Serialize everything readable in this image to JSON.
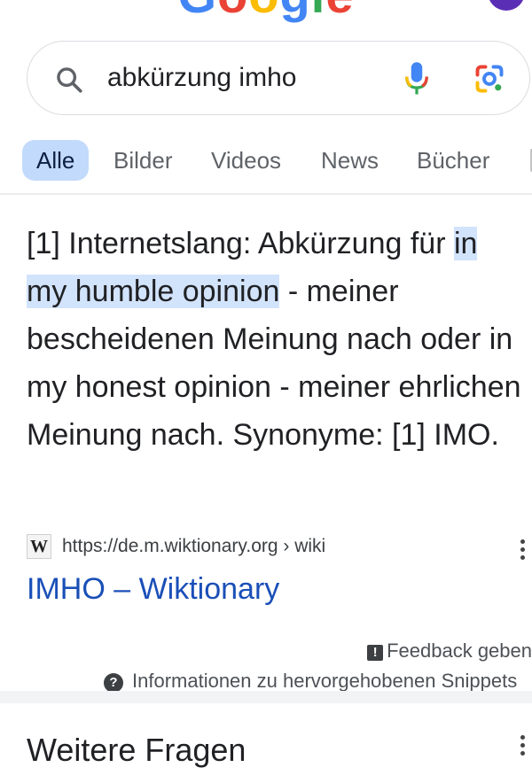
{
  "brand": {
    "logo_text": "Google",
    "colors": [
      "#4285F4",
      "#EA4335",
      "#FBBC05",
      "#4285F4",
      "#34A853",
      "#EA4335"
    ]
  },
  "search": {
    "query": "abkürzung imho"
  },
  "tabs": [
    {
      "label": "Alle",
      "active": true
    },
    {
      "label": "Bilder",
      "active": false
    },
    {
      "label": "Videos",
      "active": false
    },
    {
      "label": "News",
      "active": false
    },
    {
      "label": "Bücher",
      "active": false
    }
  ],
  "snippet": {
    "before": "[1] Internetslang: Abkürzung für ",
    "highlight": "in my humble opinion",
    "after": " - meiner bescheidenen Meinung nach oder in my honest opinion - meiner ehrlichen Meinung nach. Synonyme: [1] IMO."
  },
  "source": {
    "favicon_letter": "W",
    "url": "https://de.m.wiktionary.org › wiki",
    "title": "IMHO – Wiktionary"
  },
  "footer": {
    "feedback_label": "Feedback geben",
    "info_label": "Informationen zu hervorgehobenen Snippets"
  },
  "more_questions": {
    "title": "Weitere Fragen"
  },
  "icons": [
    "search-icon",
    "mic-icon",
    "lens-icon",
    "feedback-icon",
    "help-icon",
    "more-options-icon"
  ]
}
